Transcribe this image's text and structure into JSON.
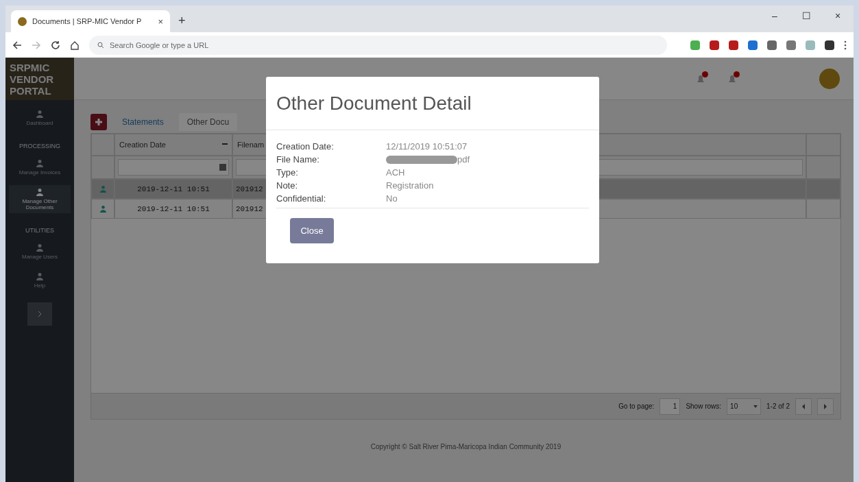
{
  "browser": {
    "tab_title": "Documents | SRP-MIC Vendor P",
    "tab_close": "×",
    "new_tab": "+",
    "address_placeholder": "Search Google or type a URL",
    "window_controls": [
      "–",
      "☐",
      "×"
    ]
  },
  "sidebar": {
    "logo_lines": [
      "SRPMIC",
      "VENDOR",
      "PORTAL"
    ],
    "items": [
      {
        "kind": "link",
        "label": "Dashboard",
        "selected": false
      },
      {
        "kind": "section",
        "label": "PROCESSING"
      },
      {
        "kind": "link",
        "label": "Manage Invoices",
        "selected": false
      },
      {
        "kind": "link",
        "label": "Manage Other Documents",
        "selected": true
      },
      {
        "kind": "section",
        "label": "UTILITIES"
      },
      {
        "kind": "link",
        "label": "Manage Users",
        "selected": false
      },
      {
        "kind": "link",
        "label": "Help",
        "selected": false
      }
    ]
  },
  "tabs": [
    {
      "label": "Statements",
      "selected": false
    },
    {
      "label": "Other Docu",
      "selected": true
    }
  ],
  "table": {
    "columns": [
      "Creation Date",
      "Filenam"
    ],
    "rows": [
      {
        "cells": [
          "2019-12-11 10:51",
          "201912"
        ],
        "selected": true
      },
      {
        "cells": [
          "2019-12-11 10:51",
          "201912"
        ],
        "selected": false
      }
    ]
  },
  "pagination": {
    "go_label": "Go to page:",
    "page": "1",
    "rows_label": "Show rows:",
    "rows": "10",
    "range": "1-2 of 2"
  },
  "footer": "Copyright © Salt River Pima-Maricopa Indian Community 2019",
  "modal": {
    "title": "Other Document Detail",
    "fields": [
      {
        "label": "Creation Date:",
        "value": "12/11/2019 10:51:07"
      },
      {
        "label": "File Name:",
        "value": "pdf",
        "redacted": true
      },
      {
        "label": "Type:",
        "value": "ACH"
      },
      {
        "label": "Note:",
        "value": "Registration"
      },
      {
        "label": "Confidential:",
        "value": "No"
      }
    ],
    "button": "Close"
  }
}
